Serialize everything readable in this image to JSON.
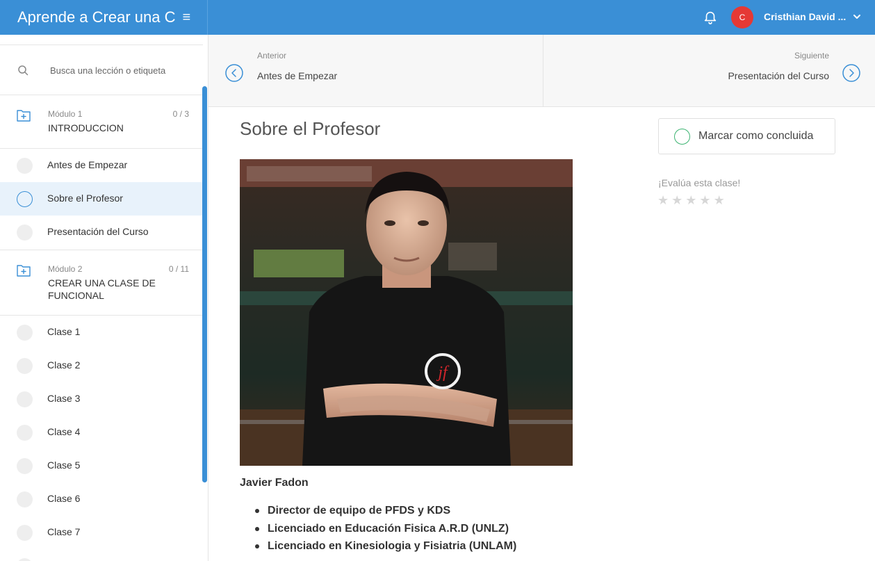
{
  "header": {
    "course_title": "Aprende a Crear una C",
    "menu_glyph": "≡",
    "avatar_initial": "C",
    "user_name": "Cristhian David ...",
    "colors": {
      "bar": "#3a8fd6",
      "avatar": "#e53935"
    }
  },
  "sidebar": {
    "search_placeholder": "Busca una lección o etiqueta",
    "modules": [
      {
        "label": "Módulo 1",
        "count": "0 / 3",
        "title": "INTRODUCCION",
        "lessons": [
          "Antes de Empezar",
          "Sobre el Profesor",
          "Presentación del Curso"
        ]
      },
      {
        "label": "Módulo 2",
        "count": "0 / 11",
        "title": "CREAR UNA CLASE DE FUNCIONAL",
        "lessons": [
          "Clase 1",
          "Clase 2",
          "Clase 3",
          "Clase 4",
          "Clase 5",
          "Clase 6",
          "Clase 7"
        ]
      }
    ],
    "active_lesson": "Sobre el Profesor"
  },
  "nav": {
    "prev_label": "Anterior",
    "prev_title": "Antes de Empezar",
    "next_label": "Siguiente",
    "next_title": "Presentación del Curso"
  },
  "content": {
    "title": "Sobre el Profesor",
    "author_name": "Javier Fadon",
    "bullets": [
      "Director de equipo de PFDS y KDS",
      "Licenciado en Educación Fisica A.R.D (UNLZ)",
      "Licenciado en Kinesiologia y Fisiatria (UNLAM)"
    ]
  },
  "actions": {
    "complete_label": "Marcar como concluida",
    "rate_label": "¡Evalúa esta clase!",
    "rating": 0,
    "rating_max": 5
  }
}
